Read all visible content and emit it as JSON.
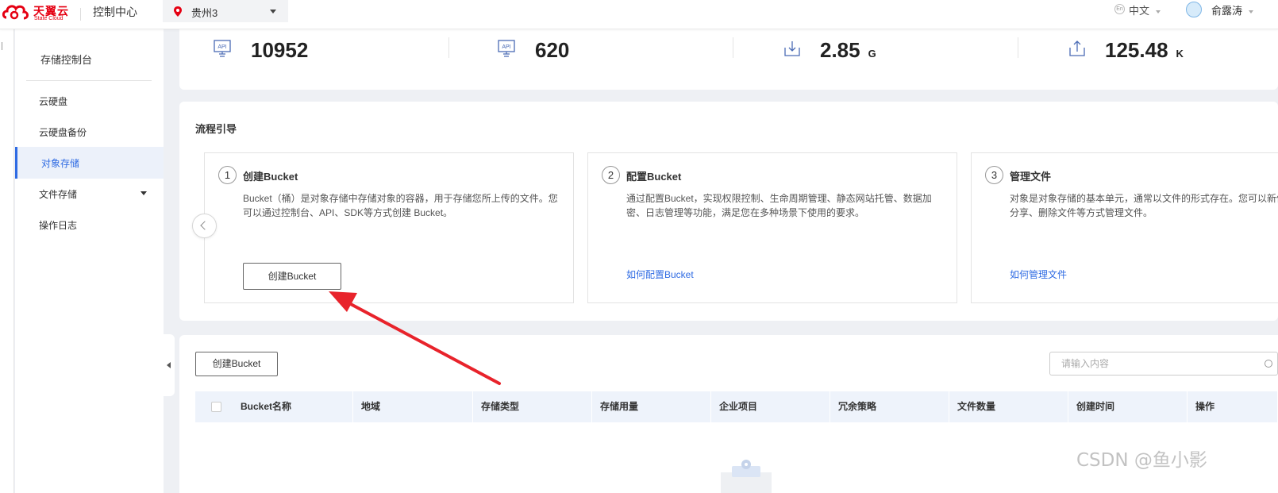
{
  "header": {
    "logo_cn": "天翼云",
    "logo_en": "State Cloud",
    "console_title": "控制中心",
    "region": "贵州3",
    "language": "中文",
    "user": "俞露涛",
    "brand_color": "#e50012"
  },
  "sidebar": {
    "title": "存储控制台",
    "items": [
      {
        "label": "云硬盘"
      },
      {
        "label": "云硬盘备份"
      },
      {
        "label": "对象存储"
      },
      {
        "label": "文件存储"
      },
      {
        "label": "操作日志"
      }
    ],
    "active_color": "#2f6be3"
  },
  "stats": [
    {
      "icon": "api-icon",
      "value": "10952",
      "unit": ""
    },
    {
      "icon": "api-icon",
      "value": "620",
      "unit": ""
    },
    {
      "icon": "download-icon",
      "value": "2.85",
      "unit": "G"
    },
    {
      "icon": "upload-icon",
      "value": "125.48",
      "unit": "K"
    }
  ],
  "guide": {
    "heading": "流程引导",
    "steps": [
      {
        "num": "1",
        "title": "创建Bucket",
        "desc": "Bucket（桶）是对象存储中存储对象的容器，用于存储您所上传的文件。您可以通过控制台、API、SDK等方式创建 Bucket。",
        "action": "创建Bucket"
      },
      {
        "num": "2",
        "title": "配置Bucket",
        "desc": "通过配置Bucket，实现权限控制、生命周期管理、静态网站托管、数据加密、日志管理等功能，满足您在多种场景下使用的要求。",
        "action": "如何配置Bucket"
      },
      {
        "num": "3",
        "title": "管理文件",
        "desc": "对象是对象存储的基本单元，通常以文件的形式存在。您可以新传、下载、分享、删除文件等方式管理文件。",
        "action": "如何管理文件"
      }
    ]
  },
  "table": {
    "create_button": "创建Bucket",
    "search_placeholder": "请输入内容",
    "columns": [
      "Bucket名称",
      "地域",
      "存储类型",
      "存储用量",
      "企业项目",
      "冗余策略",
      "文件数量",
      "创建时间",
      "操作"
    ]
  },
  "annotation": {
    "arrow_color": "#e8232b"
  },
  "watermark": "CSDN @鱼小影"
}
